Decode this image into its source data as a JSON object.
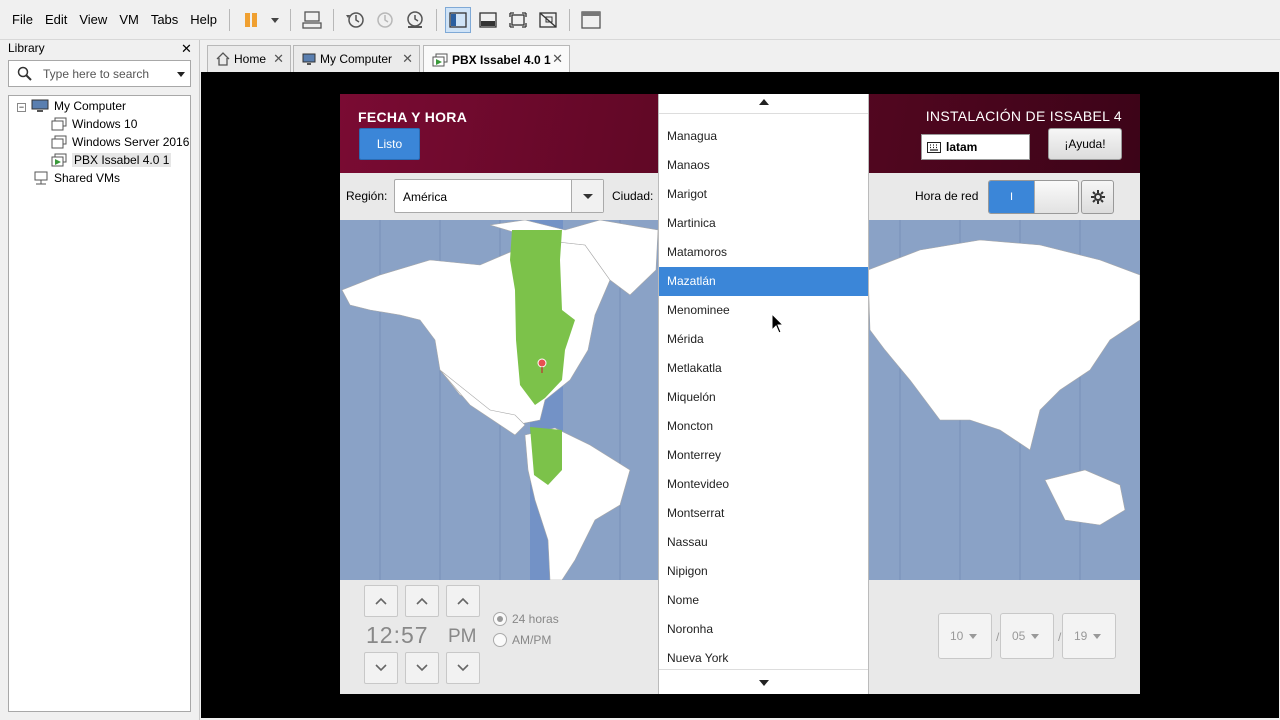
{
  "menubar": {
    "items": [
      "File",
      "Edit",
      "View",
      "VM",
      "Tabs",
      "Help"
    ]
  },
  "toolbar": {
    "icons": [
      "pause-icon",
      "dropdown-icon",
      "send-ctrl-alt-del-icon",
      "snapshot-take-icon",
      "snapshot-revert-icon",
      "snapshot-manager-icon",
      "show-library-icon",
      "thumbnail-bar-icon",
      "fullscreen-icon",
      "unity-icon",
      "console-view-icon"
    ]
  },
  "library": {
    "title": "Library",
    "search_placeholder": "Type here to search",
    "tree": {
      "root": "My Computer",
      "vms": [
        "Windows 10",
        "Windows Server 2016",
        "PBX Issabel 4.0 1"
      ],
      "shared": "Shared VMs"
    }
  },
  "tabs": [
    {
      "label": "Home",
      "icon": "home-icon"
    },
    {
      "label": "My Computer",
      "icon": "computer-icon"
    },
    {
      "label": "PBX Issabel 4.0 1",
      "icon": "vm-running-icon"
    }
  ],
  "installer": {
    "title": "FECHA Y HORA",
    "done_button": "Listo",
    "product": "INSTALACIÓN DE ISSABEL 4",
    "keyboard_layout": "latam",
    "help_button": "¡Ayuda!",
    "region_label": "Región:",
    "region_value": "América",
    "city_label": "Ciudad:",
    "network_time_label": "Hora de red",
    "network_time_on": "I",
    "time": {
      "hours": "12",
      "minutes": "57",
      "ampm": "PM"
    },
    "format_24": "24 horas",
    "format_ampm": "AM/PM",
    "date": {
      "day": "10",
      "month": "05",
      "year": "19"
    }
  },
  "city_dropdown": {
    "cities": [
      "Managua",
      "Manaos",
      "Marigot",
      "Martinica",
      "Matamoros",
      "Mazatlán",
      "Menominee",
      "Mérida",
      "Metlakatla",
      "Miquelón",
      "Moncton",
      "Monterrey",
      "Montevideo",
      "Montserrat",
      "Nassau",
      "Nipigon",
      "Nome",
      "Noronha",
      "Nueva York"
    ],
    "selected": "Mazatlán"
  },
  "colors": {
    "accent": "#3b86d8",
    "header": "#6a0a2b",
    "ocean": "#8aa2c6",
    "timezone_highlight": "#7cc24a"
  }
}
